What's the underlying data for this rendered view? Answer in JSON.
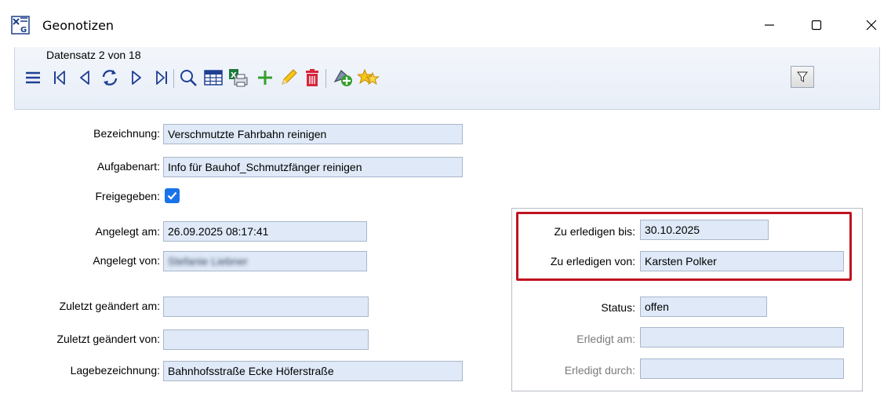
{
  "window": {
    "title": "Geonotizen",
    "app_icon": "geo-app-icon",
    "controls": {
      "minimize": "minimize-icon",
      "maximize": "maximize-icon",
      "close": "close-icon"
    }
  },
  "toolbar": {
    "record_info": "Datensatz 2 von 18",
    "buttons": [
      "menu-icon",
      "first-record-icon",
      "previous-record-icon",
      "refresh-icon",
      "next-record-icon",
      "last-record-icon",
      "search-icon",
      "table-view-icon",
      "excel-export-icon",
      "add-icon",
      "edit-icon",
      "delete-icon",
      "add-geometry-icon",
      "favorites-icon",
      "filter-icon"
    ]
  },
  "form": {
    "bezeichnung": {
      "label": "Bezeichnung:",
      "value": "Verschmutzte Fahrbahn reinigen"
    },
    "aufgabenart": {
      "label": "Aufgabenart:",
      "value": "Info für Bauhof_Schmutzfänger reinigen"
    },
    "freigegeben": {
      "label": "Freigegeben:",
      "checked": true
    },
    "angelegt_am": {
      "label": "Angelegt am:",
      "value": "26.09.2025 08:17:41"
    },
    "angelegt_von": {
      "label": "Angelegt von:",
      "value": "Stefanie Liebner"
    },
    "zuletzt_am": {
      "label": "Zuletzt geändert am:",
      "value": ""
    },
    "zuletzt_von": {
      "label": "Zuletzt geändert von:",
      "value": ""
    },
    "lagebezeichnung": {
      "label": "Lagebezeichnung:",
      "value": "Bahnhofsstraße Ecke Höferstraße"
    },
    "zu_erledigen_bis": {
      "label": "Zu erledigen bis:",
      "value": "30.10.2025"
    },
    "zu_erledigen_von": {
      "label": "Zu erledigen von:",
      "value": "Karsten Polker"
    },
    "status": {
      "label": "Status:",
      "value": "offen"
    },
    "erledigt_am": {
      "label": "Erledigt am:",
      "value": ""
    },
    "erledigt_durch": {
      "label": "Erledigt durch:",
      "value": ""
    }
  },
  "colors": {
    "highlight": "#c1121f",
    "field_bg": "#dfe9f7",
    "checkbox": "#1a73e8"
  }
}
